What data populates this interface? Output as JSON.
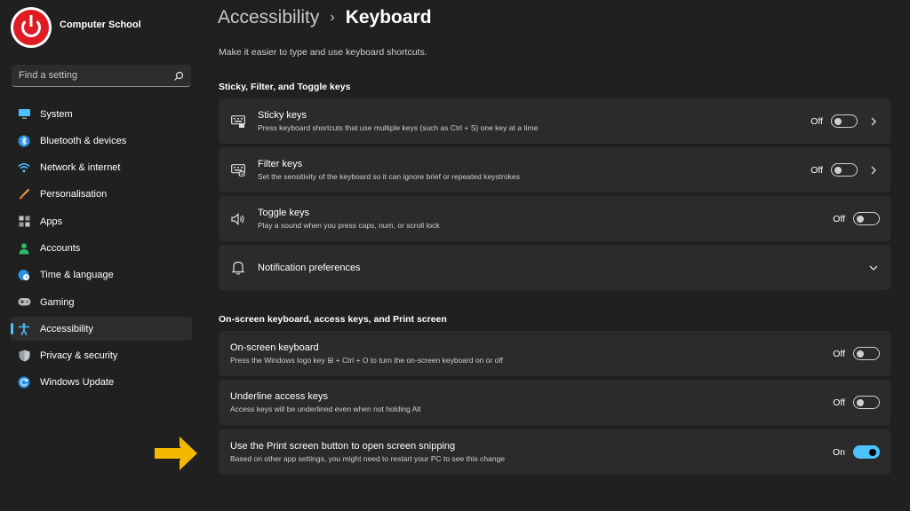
{
  "profile": {
    "name": "Computer School"
  },
  "search": {
    "placeholder": "Find a setting"
  },
  "sidebar": {
    "items": [
      {
        "label": "System",
        "icon": "monitor-icon"
      },
      {
        "label": "Bluetooth & devices",
        "icon": "bluetooth-icon"
      },
      {
        "label": "Network & internet",
        "icon": "wifi-icon"
      },
      {
        "label": "Personalisation",
        "icon": "brush-icon"
      },
      {
        "label": "Apps",
        "icon": "apps-icon"
      },
      {
        "label": "Accounts",
        "icon": "person-icon"
      },
      {
        "label": "Time & language",
        "icon": "globe-clock-icon"
      },
      {
        "label": "Gaming",
        "icon": "gamepad-icon"
      },
      {
        "label": "Accessibility",
        "icon": "accessibility-icon",
        "active": true
      },
      {
        "label": "Privacy & security",
        "icon": "shield-icon"
      },
      {
        "label": "Windows Update",
        "icon": "update-icon"
      }
    ]
  },
  "header": {
    "parent": "Accessibility",
    "separator": "›",
    "current": "Keyboard",
    "subtitle": "Make it easier to type and use keyboard shortcuts."
  },
  "sections": {
    "sticky": {
      "title": "Sticky, Filter, and Toggle keys",
      "items": [
        {
          "title": "Sticky keys",
          "desc": "Press keyboard shortcuts that use multiple keys (such as Ctrl + S) one key at a time",
          "state": "Off",
          "on": false,
          "icon": "sticky-keys-icon"
        },
        {
          "title": "Filter keys",
          "desc": "Set the sensitivity of the keyboard so it can ignore brief or repeated keystrokes",
          "state": "Off",
          "on": false,
          "icon": "filter-keys-icon"
        },
        {
          "title": "Toggle keys",
          "desc": "Play a sound when you press caps, num, or scroll lock",
          "state": "Off",
          "on": false,
          "icon": "speaker-icon"
        },
        {
          "title": "Notification preferences",
          "icon": "bell-icon"
        }
      ]
    },
    "onscreen": {
      "title": "On-screen keyboard, access keys, and Print screen",
      "items": [
        {
          "title": "On-screen keyboard",
          "desc": "Press the Windows logo key ⊞ + Ctrl + O to turn the on-screen keyboard on or off",
          "state": "Off",
          "on": false
        },
        {
          "title": "Underline access keys",
          "desc": "Access keys will be underlined even when not holding Alt",
          "state": "Off",
          "on": false
        },
        {
          "title": "Use the Print screen button to open screen snipping",
          "desc": "Based on other app settings, you might need to restart your PC to see this change",
          "state": "On",
          "on": true
        }
      ]
    }
  },
  "colors": {
    "accent": "#4cc2ff",
    "arrow": "#f5b800",
    "background": "#202020",
    "card": "#2b2b2b",
    "logo_red": "#e01b24"
  }
}
